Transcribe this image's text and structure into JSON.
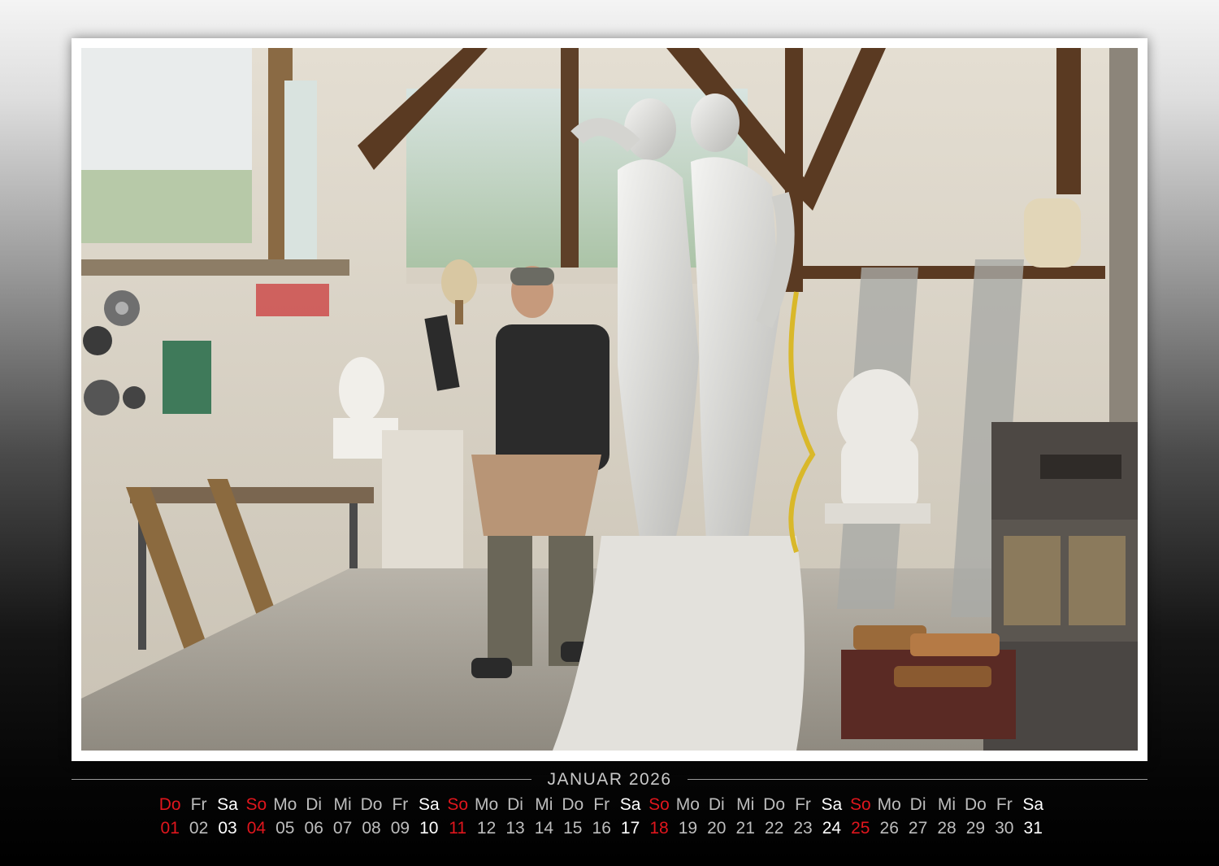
{
  "calendar": {
    "title": "JANUAR 2026",
    "colors": {
      "weekday": "#bdbdbd",
      "saturday": "#ffffff",
      "sunday": "#e0161d",
      "title": "#c9c9c9",
      "rule": "#9a9a9a"
    },
    "days": [
      {
        "wd": "Do",
        "n": "01",
        "type": "holiday"
      },
      {
        "wd": "Fr",
        "n": "02",
        "type": "weekday"
      },
      {
        "wd": "Sa",
        "n": "03",
        "type": "sat"
      },
      {
        "wd": "So",
        "n": "04",
        "type": "sun"
      },
      {
        "wd": "Mo",
        "n": "05",
        "type": "weekday"
      },
      {
        "wd": "Di",
        "n": "06",
        "type": "weekday"
      },
      {
        "wd": "Mi",
        "n": "07",
        "type": "weekday"
      },
      {
        "wd": "Do",
        "n": "08",
        "type": "weekday"
      },
      {
        "wd": "Fr",
        "n": "09",
        "type": "weekday"
      },
      {
        "wd": "Sa",
        "n": "10",
        "type": "sat"
      },
      {
        "wd": "So",
        "n": "11",
        "type": "sun"
      },
      {
        "wd": "Mo",
        "n": "12",
        "type": "weekday"
      },
      {
        "wd": "Di",
        "n": "13",
        "type": "weekday"
      },
      {
        "wd": "Mi",
        "n": "14",
        "type": "weekday"
      },
      {
        "wd": "Do",
        "n": "15",
        "type": "weekday"
      },
      {
        "wd": "Fr",
        "n": "16",
        "type": "weekday"
      },
      {
        "wd": "Sa",
        "n": "17",
        "type": "sat"
      },
      {
        "wd": "So",
        "n": "18",
        "type": "sun"
      },
      {
        "wd": "Mo",
        "n": "19",
        "type": "weekday"
      },
      {
        "wd": "Di",
        "n": "20",
        "type": "weekday"
      },
      {
        "wd": "Mi",
        "n": "21",
        "type": "weekday"
      },
      {
        "wd": "Do",
        "n": "22",
        "type": "weekday"
      },
      {
        "wd": "Fr",
        "n": "23",
        "type": "weekday"
      },
      {
        "wd": "Sa",
        "n": "24",
        "type": "sat"
      },
      {
        "wd": "So",
        "n": "25",
        "type": "sun"
      },
      {
        "wd": "Mo",
        "n": "26",
        "type": "weekday"
      },
      {
        "wd": "Di",
        "n": "27",
        "type": "weekday"
      },
      {
        "wd": "Mi",
        "n": "28",
        "type": "weekday"
      },
      {
        "wd": "Do",
        "n": "29",
        "type": "weekday"
      },
      {
        "wd": "Fr",
        "n": "30",
        "type": "weekday"
      },
      {
        "wd": "Sa",
        "n": "31",
        "type": "sat"
      }
    ]
  }
}
